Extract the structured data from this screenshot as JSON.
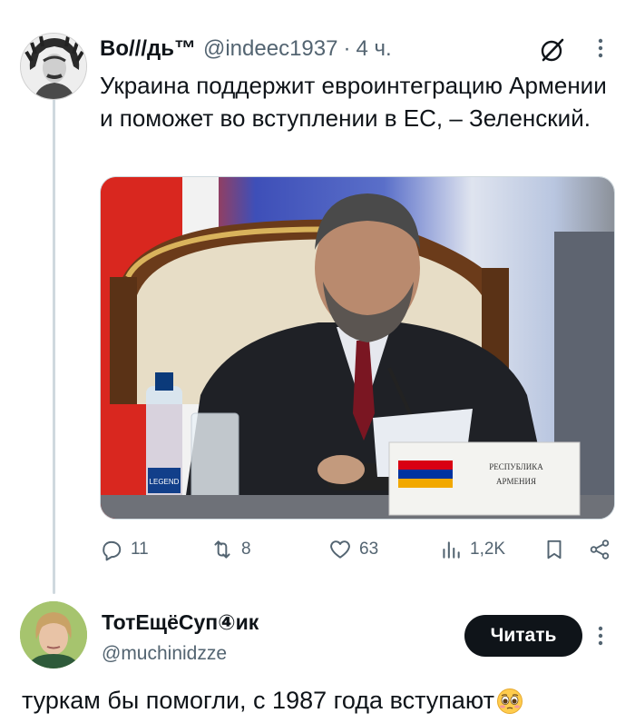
{
  "tweet1": {
    "author_name": "Bo///дь™",
    "handle": "@indeec1937",
    "separator": "·",
    "time": "4 ч.",
    "text": "Украина поддержит евроинтеграцию Армении и поможет во вступлении в ЕС, – Зеленский.",
    "media": {
      "nameplate_line1": "РЕСПУБЛИКА",
      "nameplate_line2": "АРМЕНИЯ",
      "bottle_label": "LEGEND"
    },
    "actions": {
      "replies": "11",
      "reposts": "8",
      "likes": "63",
      "views": "1,2K"
    }
  },
  "tweet2": {
    "author_name": "ТотЕщёСуп④ик",
    "handle": "@muchinidzze",
    "follow_label": "Читать",
    "text": "туркам бы помогли, с 1987 года вступают"
  },
  "icons": {
    "grok": "grok-slash-icon",
    "more": "more-vertical-icon",
    "reply": "reply-icon",
    "repost": "repost-icon",
    "like": "heart-icon",
    "views": "views-icon",
    "bookmark": "bookmark-icon",
    "share": "share-icon",
    "emoji": "pleading-face-emoji"
  },
  "colors": {
    "text": "#0f1419",
    "secondary": "#536471",
    "button_bg": "#0f1419",
    "thread_line": "#cfd9de"
  }
}
